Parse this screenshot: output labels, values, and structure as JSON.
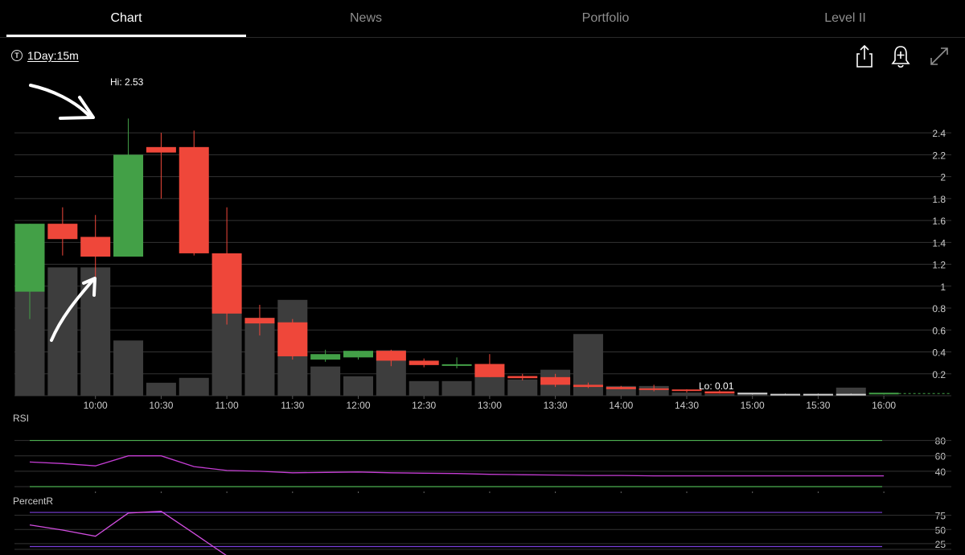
{
  "tabs": [
    {
      "label": "Chart",
      "active": true
    },
    {
      "label": "News",
      "active": false
    },
    {
      "label": "Portfolio",
      "active": false
    },
    {
      "label": "Level II",
      "active": false
    }
  ],
  "toolbar": {
    "interval_icon": "T",
    "interval_label": "1Day:15m",
    "icons": [
      "share-icon",
      "alert-bell-icon",
      "expand-icon"
    ]
  },
  "colors": {
    "up": "#43a047",
    "down": "#ef473a",
    "volume": "#3d3d3d",
    "grid": "#333333",
    "rsi": "#c53dd4",
    "rsi_band": "#4caf50",
    "percentr": "#d24de0",
    "percentr_band": "#7a3fd9"
  },
  "chart_data": [
    {
      "type": "candlestick",
      "hi_label": "Hi: 2.53",
      "lo_label": "Lo: 0.01",
      "yticks": [
        "2.4",
        "2.2",
        "2",
        "1.8",
        "1.6",
        "1.4",
        "1.2",
        "1",
        "0.8",
        "0.6",
        "0.4",
        "0.2"
      ],
      "xticks": [
        "10:00",
        "10:30",
        "11:00",
        "11:30",
        "12:00",
        "12:30",
        "13:00",
        "13:30",
        "14:00",
        "14:30",
        "15:00",
        "15:30",
        "16:00"
      ],
      "ylim": [
        0,
        2.6
      ],
      "grid": true,
      "candles": [
        {
          "t": "09:30",
          "o": 0.95,
          "h": 1.57,
          "l": 0.7,
          "c": 1.57
        },
        {
          "t": "09:45",
          "o": 1.57,
          "h": 1.72,
          "l": 1.28,
          "c": 1.43
        },
        {
          "t": "10:00",
          "o": 1.45,
          "h": 1.65,
          "l": 0.97,
          "c": 1.27
        },
        {
          "t": "10:15",
          "o": 1.27,
          "h": 2.53,
          "l": 1.27,
          "c": 2.2
        },
        {
          "t": "10:30",
          "o": 2.27,
          "h": 2.4,
          "l": 1.8,
          "c": 2.22
        },
        {
          "t": "10:45",
          "o": 2.27,
          "h": 2.42,
          "l": 1.28,
          "c": 1.3
        },
        {
          "t": "11:00",
          "o": 1.3,
          "h": 1.72,
          "l": 0.65,
          "c": 0.75
        },
        {
          "t": "11:15",
          "o": 0.71,
          "h": 0.83,
          "l": 0.55,
          "c": 0.66
        },
        {
          "t": "11:30",
          "o": 0.67,
          "h": 0.7,
          "l": 0.33,
          "c": 0.36
        },
        {
          "t": "11:45",
          "o": 0.33,
          "h": 0.42,
          "l": 0.31,
          "c": 0.38
        },
        {
          "t": "12:00",
          "o": 0.35,
          "h": 0.41,
          "l": 0.33,
          "c": 0.41
        },
        {
          "t": "12:15",
          "o": 0.41,
          "h": 0.42,
          "l": 0.27,
          "c": 0.32
        },
        {
          "t": "12:30",
          "o": 0.32,
          "h": 0.34,
          "l": 0.26,
          "c": 0.28
        },
        {
          "t": "12:45",
          "o": 0.28,
          "h": 0.35,
          "l": 0.25,
          "c": 0.28
        },
        {
          "t": "13:00",
          "o": 0.29,
          "h": 0.38,
          "l": 0.17,
          "c": 0.17
        },
        {
          "t": "13:15",
          "o": 0.18,
          "h": 0.2,
          "l": 0.14,
          "c": 0.16
        },
        {
          "t": "13:30",
          "o": 0.17,
          "h": 0.2,
          "l": 0.08,
          "c": 0.1
        },
        {
          "t": "13:45",
          "o": 0.1,
          "h": 0.12,
          "l": 0.07,
          "c": 0.08
        },
        {
          "t": "14:00",
          "o": 0.08,
          "h": 0.09,
          "l": 0.06,
          "c": 0.06
        },
        {
          "t": "14:15",
          "o": 0.06,
          "h": 0.1,
          "l": 0.04,
          "c": 0.05
        },
        {
          "t": "14:30",
          "o": 0.05,
          "h": 0.06,
          "l": 0.03,
          "c": 0.04
        },
        {
          "t": "14:45",
          "o": 0.04,
          "h": 0.05,
          "l": 0.02,
          "c": 0.02
        },
        {
          "t": "15:00",
          "o": 0.02,
          "h": 0.02,
          "l": 0.01,
          "c": 0.01
        },
        {
          "t": "15:15",
          "o": 0.01,
          "h": 0.02,
          "l": 0.01,
          "c": 0.01
        },
        {
          "t": "15:30",
          "o": 0.01,
          "h": 0.02,
          "l": 0.01,
          "c": 0.01
        },
        {
          "t": "15:45",
          "o": 0.01,
          "h": 0.02,
          "l": 0.01,
          "c": 0.01
        },
        {
          "t": "16:00",
          "o": 0.01,
          "h": 0.02,
          "l": 0.01,
          "c": 0.02
        }
      ],
      "volume_relative": [
        0.88,
        0.79,
        0.79,
        0.34,
        0.08,
        0.11,
        0.65,
        0.48,
        0.59,
        0.18,
        0.12,
        0.28,
        0.09,
        0.09,
        0.16,
        0.1,
        0.16,
        0.38,
        0.06,
        0.06,
        0.02,
        0.01,
        0.02,
        0.01,
        0.01,
        0.05
      ]
    },
    {
      "type": "line",
      "title": "RSI",
      "yticks": [
        "80",
        "60",
        "40"
      ],
      "ylim": [
        20,
        90
      ],
      "bands": [
        80,
        20
      ],
      "values": [
        52,
        50,
        47,
        60,
        60,
        46,
        41,
        40,
        38,
        38.5,
        39,
        38,
        37.5,
        37,
        36,
        35.5,
        35,
        34.5,
        34.5,
        34,
        34,
        34,
        34,
        34,
        34,
        34,
        34
      ]
    },
    {
      "type": "line",
      "title": "PercentR",
      "yticks": [
        "75",
        "50",
        "25"
      ],
      "ylim": [
        15,
        90
      ],
      "bands": [
        80,
        20
      ],
      "values": [
        58,
        49,
        38,
        79,
        82,
        43,
        2,
        0,
        0,
        0,
        0,
        0,
        0,
        0,
        0,
        0,
        0,
        0,
        0,
        0,
        0,
        0,
        0,
        0,
        0,
        0,
        0
      ]
    }
  ]
}
